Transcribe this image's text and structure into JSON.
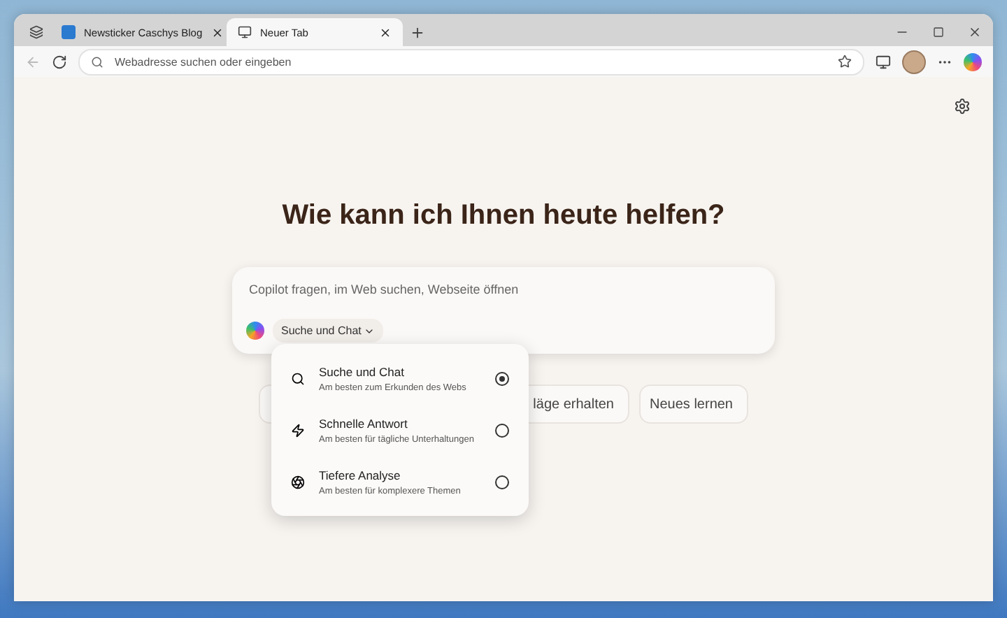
{
  "tabs": [
    {
      "title": "Newsticker Caschys Blog",
      "kind": "site",
      "selected": false
    },
    {
      "title": "Neuer Tab",
      "kind": "newtab",
      "selected": true
    }
  ],
  "address_bar": {
    "placeholder": "Webadresse suchen oder eingeben"
  },
  "heading": "Wie kann ich Ihnen heute helfen?",
  "prompt": {
    "placeholder": "Copilot fragen, im Web suchen, Webseite öffnen",
    "mode": "Suche und Chat"
  },
  "chips": [
    {
      "label": "läge erhalten"
    },
    {
      "label": "Neues lernen"
    }
  ],
  "mode_menu": [
    {
      "kind": "search",
      "title": "Suche und Chat",
      "subtitle": "Am besten zum Erkunden des Webs",
      "selected": true
    },
    {
      "kind": "quick",
      "title": "Schnelle Antwort",
      "subtitle": "Am besten für tägliche Unterhaltungen",
      "selected": false
    },
    {
      "kind": "deep",
      "title": "Tiefere Analyse",
      "subtitle": "Am besten für komplexere Themen",
      "selected": false
    }
  ]
}
